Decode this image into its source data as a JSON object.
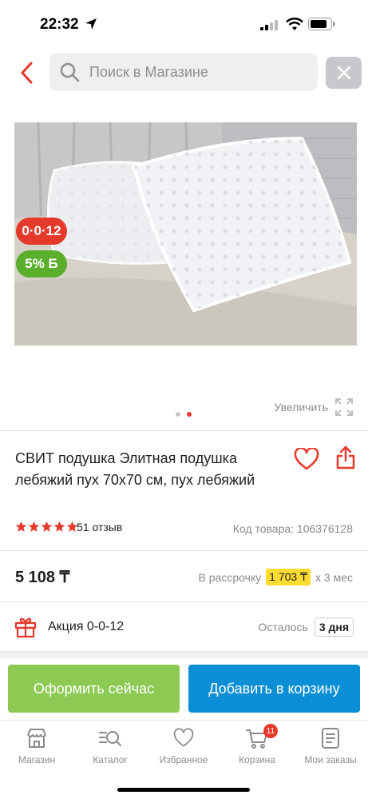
{
  "status_bar": {
    "time": "22:32"
  },
  "search": {
    "placeholder": "Поиск в Магазине"
  },
  "badges": {
    "installment": "0·0·12",
    "bonus": "5% Б"
  },
  "gallery": {
    "zoom_label": "Увеличить",
    "pages": 2,
    "active_page": 2
  },
  "product": {
    "title": "СВИТ подушка Элитная подушка лебяжий пух 70x70 см, пух лебяжий",
    "rating": 5,
    "reviews": "51 отзыв",
    "code": "Код товара: 106376128",
    "price": "5 108 ₸",
    "installment_prefix": "В рассрочку",
    "installment_amount": "1 703 ₸",
    "installment_suffix": "х 3 мес"
  },
  "promo": {
    "label": "Акция 0-0-12",
    "remaining_label": "Осталось",
    "remaining_value": "3 дня"
  },
  "actions": {
    "buy_now": "Оформить сейчас",
    "add_to_cart": "Добавить в корзину"
  },
  "tabbar": {
    "items": [
      {
        "label": "Магазин",
        "icon": "store-icon"
      },
      {
        "label": "Каталог",
        "icon": "catalog-search-icon"
      },
      {
        "label": "Избранное",
        "icon": "heart-icon"
      },
      {
        "label": "Корзина",
        "icon": "cart-icon",
        "badge": "11"
      },
      {
        "label": "Мои заказы",
        "icon": "orders-icon"
      }
    ]
  },
  "colors": {
    "accent_red": "#e5392b",
    "buy_green": "#8dca53",
    "cart_blue": "#0a8fd6",
    "installment_yellow": "#fedc32"
  }
}
